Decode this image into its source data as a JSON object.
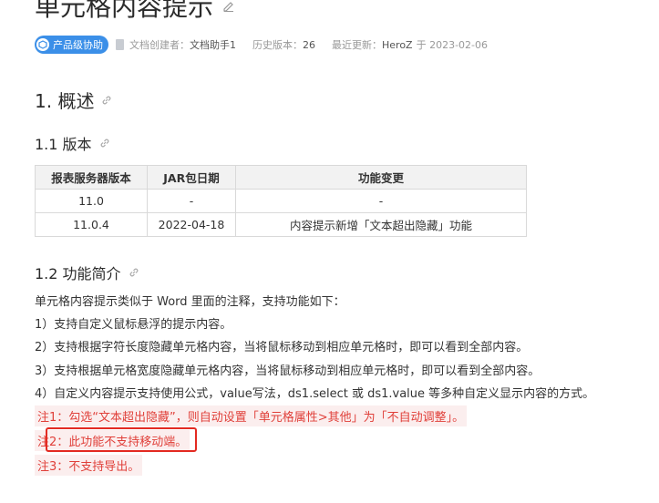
{
  "title": "单元格内容提示",
  "meta": {
    "badge": "产品级协助",
    "creator_label": "文档创建者：",
    "creator": "文档助手1",
    "history_label": "历史版本：",
    "history": "26",
    "updated_label": "最近更新：",
    "updated_by": "HeroZ",
    "updated_at": "于 2023-02-06"
  },
  "sections": {
    "overview": "1. 概述",
    "version": "1.1 版本",
    "intro": "1.2 功能简介"
  },
  "version_table": {
    "headers": [
      "报表服务器版本",
      "JAR包日期",
      "功能变更"
    ],
    "rows": [
      [
        "11.0",
        "-",
        "-"
      ],
      [
        "11.0.4",
        "2022-04-18",
        "内容提示新增「文本超出隐藏」功能"
      ]
    ]
  },
  "intro": {
    "lead": "单元格内容提示类似于 Word 里面的注释，支持功能如下：",
    "items": [
      "1）支持自定义鼠标悬浮的提示内容。",
      "2）支持根据字符长度隐藏单元格内容，当将鼠标移动到相应单元格时，即可以看到全部内容。",
      "3）支持根据单元格宽度隐藏单元格内容，当将鼠标移动到相应单元格时，即可以看到全部内容。",
      "4）自定义内容提示支持使用公式，value写法，ds1.select 或 ds1.value 等多种自定义显示内容的方式。"
    ],
    "notes": [
      "注1：勾选“文本超出隐藏”，则自动设置「单元格属性>其他」为「不自动调整」。",
      "注2：此功能不支持移动端。",
      "注3：不支持导出。"
    ]
  },
  "colors": {
    "badge": "#3b8fe8",
    "note_text": "#e0403a",
    "note_bg": "#fbeeee",
    "highlight_box": "#e32a22"
  }
}
